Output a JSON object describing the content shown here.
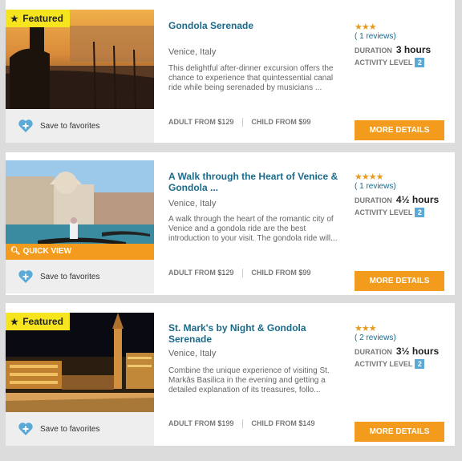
{
  "tours": [
    {
      "featured": "Featured",
      "quick_view": "",
      "title": "Gondola Serenade",
      "location": "Venice, Italy",
      "description": "This delightful after-dinner excursion offers the chance to experience that quintessential canal ride while being serenaded by musicians ...",
      "adult_label": "ADULT FROM",
      "adult_price": "$129",
      "child_label": "CHILD FROM",
      "child_price": "$99",
      "stars": "★★★",
      "reviews": "( 1 reviews)",
      "duration_label": "DURATION",
      "duration": "3 hours",
      "level_label": "ACTIVITY LEVEL",
      "level": "2",
      "save_label": "Save to favorites",
      "button": "MORE DETAILS"
    },
    {
      "featured": "",
      "quick_view": "QUICK VIEW",
      "title": "A Walk through the Heart of Venice & Gondola ...",
      "location": "Venice, Italy",
      "description": "A walk through the heart of the romantic city of Venice and a gondola ride are the best introduction to your visit. The gondola ride will...",
      "adult_label": "ADULT FROM",
      "adult_price": "$129",
      "child_label": "CHILD FROM",
      "child_price": "$99",
      "stars": "★★★★",
      "reviews": "( 1 reviews)",
      "duration_label": "DURATION",
      "duration": "4½ hours",
      "level_label": "ACTIVITY LEVEL",
      "level": "2",
      "save_label": "Save to favorites",
      "button": "MORE DETAILS"
    },
    {
      "featured": "Featured",
      "quick_view": "",
      "title": "St. Mark's by Night & Gondola Serenade",
      "location": "Venice, Italy",
      "description": "Combine the unique experience of visiting St. Markâs Basilica in the evening and getting a detailed explanation of its treasures, follo...",
      "adult_label": "ADULT FROM",
      "adult_price": "$199",
      "child_label": "CHILD FROM",
      "child_price": "$149",
      "stars": "★★★",
      "reviews": "( 2 reviews)",
      "duration_label": "DURATION",
      "duration": "3½ hours",
      "level_label": "ACTIVITY LEVEL",
      "level": "2",
      "save_label": "Save to favorites",
      "button": "MORE DETAILS"
    }
  ],
  "icons": {
    "featured_star": "star-icon",
    "favorite": "heart-plus-icon",
    "quick_view": "magnifier-icon"
  },
  "colors": {
    "accent_orange": "#f39b1c",
    "featured_yellow": "#f6e51e",
    "title_blue": "#1a6a8a",
    "level_blue": "#5aa9d6"
  }
}
